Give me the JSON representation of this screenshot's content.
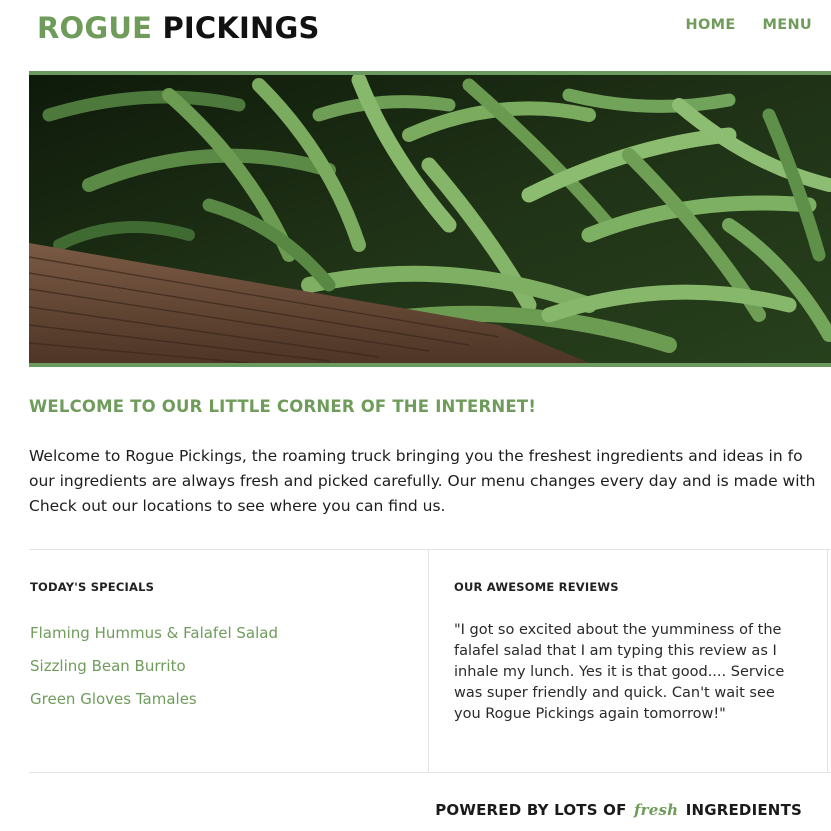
{
  "brand": {
    "first": "ROGUE",
    "second": "PICKINGS"
  },
  "nav": {
    "home": "HOME",
    "menu": "MENU"
  },
  "hero": {
    "image_subject": "green beans in a wooden crate"
  },
  "welcome": {
    "title": "WELCOME TO OUR LITTLE CORNER OF THE INTERNET!",
    "lines": [
      "Welcome to Rogue Pickings, the roaming truck bringing you the freshest ingredients and ideas in fo",
      "our ingredients are always fresh and picked carefully. Our menu changes every day and is made with",
      "Check out our locations to see where you can find us."
    ]
  },
  "specials": {
    "title": "TODAY'S SPECIALS",
    "items": [
      "Flaming Hummus & Falafel Salad",
      "Sizzling Bean Burrito",
      "Green Gloves Tamales"
    ]
  },
  "reviews": {
    "title": "OUR AWESOME REVIEWS",
    "text": "\"I got so excited about the yumminess of the falafel salad that I am typing this review as I inhale my lunch. Yes it is that good.... Service was super friendly and quick. Can't wait see you Rogue Pickings again tomorrow!\""
  },
  "footer": {
    "prefix": "POWERED BY LOTS OF",
    "fresh": "fresh",
    "suffix": "INGREDIENTS"
  },
  "colors": {
    "accent": "#6f9c5b",
    "hero_border": "#6b9a5e",
    "divider": "#e3e3e3"
  }
}
